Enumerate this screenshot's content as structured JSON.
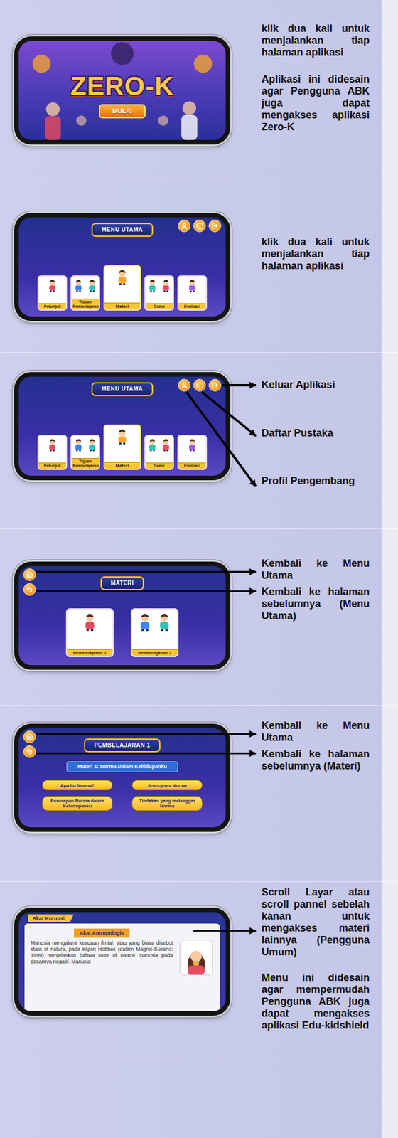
{
  "sections": [
    {
      "kind": "splash",
      "screen": {
        "title": "ZERO-K",
        "button": "MULAI"
      },
      "notes": [
        "klik dua kali untuk menjalankan tiap halaman aplikasi",
        "Aplikasi ini didesain agar Pengguna ABK juga dapat mengakses aplikasi Zero-K"
      ]
    },
    {
      "kind": "menu",
      "screen": {
        "title": "MENU UTAMA",
        "cards": [
          {
            "label": "Petunjuk",
            "selected": false
          },
          {
            "label": "Tujuan Pembelajaran",
            "selected": false
          },
          {
            "label": "Materi",
            "selected": true
          },
          {
            "label": "Game",
            "selected": false
          },
          {
            "label": "Evaluasi",
            "selected": false
          }
        ]
      },
      "notes": [
        "klik dua kali untuk menjalankan tiap halaman aplikasi"
      ]
    },
    {
      "kind": "menu-icons",
      "screen": {
        "title": "MENU UTAMA",
        "cards": [
          {
            "label": "Petunjuk",
            "selected": false
          },
          {
            "label": "Tujuan Pembelajaran",
            "selected": false
          },
          {
            "label": "Materi",
            "selected": true
          },
          {
            "label": "Game",
            "selected": false
          },
          {
            "label": "Evaluasi",
            "selected": false
          }
        ]
      },
      "notes": [
        "Keluar Aplikasi",
        "Daftar Pustaka",
        "Profil Pengembang"
      ]
    },
    {
      "kind": "materi",
      "screen": {
        "title": "MATERI",
        "cards": [
          {
            "label": "Pembelajaran 1"
          },
          {
            "label": "Pembelajaran 2"
          }
        ]
      },
      "notes": [
        "Kembali ke Menu Utama",
        "Kembali ke halaman sebelumnya (Menu Utama)"
      ]
    },
    {
      "kind": "pembelajaran",
      "screen": {
        "title": "PEMBELAJARAN 1",
        "subtitle": "Materi 1: Norma Dalam Kehidupanku",
        "buttons": [
          "Apa Itu Norma?",
          "Jenis-jenis Norma",
          "Penerapan Norma dalam Kehidupanku",
          "Tindakan yang melanggar Norma"
        ]
      },
      "notes": [
        "Kembali ke Menu Utama",
        "Kembali ke halaman sebelumnya (Materi)"
      ]
    },
    {
      "kind": "reading",
      "screen": {
        "tab": "Akar Korupsi",
        "heading": "Akar Antropologis",
        "paragraph": "Manusia mengalami keadaan ilmiah atau yang biasa disebut state of nature, pada kajian Hobbes (dalam Magnis-Suseno: 1999) menjelaskan bahwa state of nature manusia pada dasarnya negatif. Manusia"
      },
      "notes": [
        "Scroll Layar atau scroll pannel sebelah kanan untuk mengakses materi lainnya (Pengguna Umum)",
        "Menu ini didesain agar mempermudah Pengguna ABK juga dapat mengakses aplikasi Edu-kidshield"
      ]
    }
  ]
}
